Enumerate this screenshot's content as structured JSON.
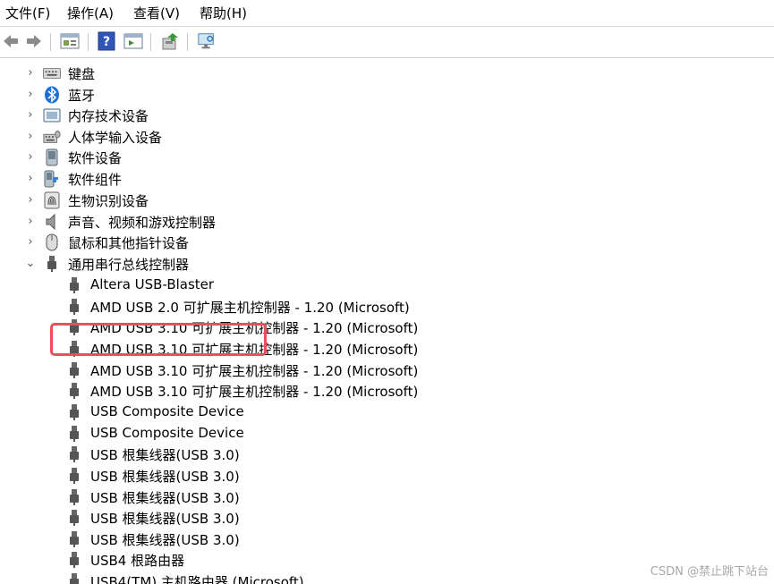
{
  "menu": [
    "文件(F)",
    "操作(A)",
    "查看(V)",
    "帮助(H)"
  ],
  "toolbar": [
    {
      "name": "back-arrow-icon"
    },
    {
      "name": "forward-arrow-icon"
    },
    {
      "name": "properties-icon"
    },
    {
      "name": "help-icon"
    },
    {
      "name": "view-pane-icon"
    },
    {
      "name": "update-driver-icon"
    },
    {
      "name": "scan-hardware-icon"
    }
  ],
  "categories": [
    {
      "label": "键盘",
      "icon": "keyboard-icon"
    },
    {
      "label": "蓝牙",
      "icon": "bluetooth-icon"
    },
    {
      "label": "内存技术设备",
      "icon": "memory-icon"
    },
    {
      "label": "人体学输入设备",
      "icon": "hid-icon"
    },
    {
      "label": "软件设备",
      "icon": "software-device-icon"
    },
    {
      "label": "软件组件",
      "icon": "software-component-icon"
    },
    {
      "label": "生物识别设备",
      "icon": "biometric-icon"
    },
    {
      "label": "声音、视频和游戏控制器",
      "icon": "speaker-icon"
    },
    {
      "label": "鼠标和其他指针设备",
      "icon": "mouse-icon"
    }
  ],
  "usb_category": {
    "label": "通用串行总线控制器",
    "icon": "usb-icon",
    "expanded": true
  },
  "usb_devices": [
    "Altera USB-Blaster",
    "AMD USB 2.0 可扩展主机控制器 - 1.20 (Microsoft)",
    "AMD USB 3.10 可扩展主机控制器 - 1.20 (Microsoft)",
    "AMD USB 3.10 可扩展主机控制器 - 1.20 (Microsoft)",
    "AMD USB 3.10 可扩展主机控制器 - 1.20 (Microsoft)",
    "AMD USB 3.10 可扩展主机控制器 - 1.20 (Microsoft)",
    "USB Composite Device",
    "USB Composite Device",
    "USB 根集线器(USB 3.0)",
    "USB 根集线器(USB 3.0)",
    "USB 根集线器(USB 3.0)",
    "USB 根集线器(USB 3.0)",
    "USB 根集线器(USB 3.0)",
    "USB4 根路由器",
    "USB4(TM) 主机路由器 (Microsoft)"
  ],
  "highlight_color": "#e9505c",
  "watermark": "CSDN @禁止跳下站台"
}
